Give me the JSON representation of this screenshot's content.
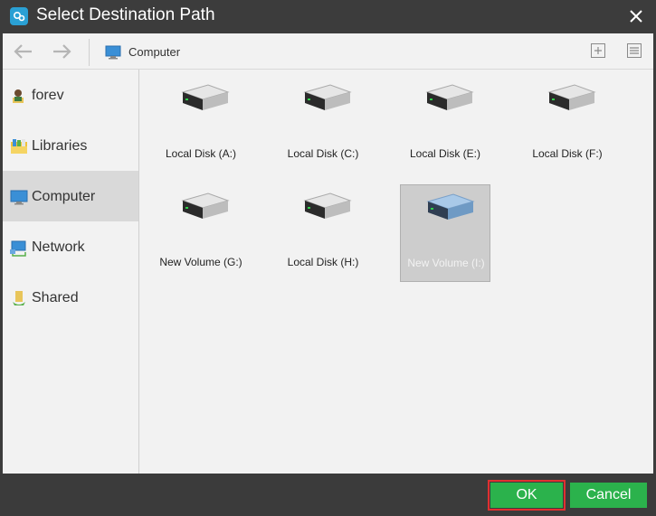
{
  "window": {
    "title": "Select Destination Path"
  },
  "toolbar": {
    "location": "Computer"
  },
  "sidebar": {
    "items": [
      {
        "label": "forev",
        "icon": "user-folder-icon"
      },
      {
        "label": "Libraries",
        "icon": "libraries-icon"
      },
      {
        "label": "Computer",
        "icon": "computer-icon",
        "selected": true
      },
      {
        "label": "Network",
        "icon": "network-icon"
      },
      {
        "label": "Shared",
        "icon": "shared-icon"
      }
    ]
  },
  "drives": [
    {
      "label": "Local Disk (A:)"
    },
    {
      "label": "Local Disk (C:)"
    },
    {
      "label": "Local Disk (E:)"
    },
    {
      "label": "Local Disk (F:)"
    },
    {
      "label": "New Volume (G:)"
    },
    {
      "label": "Local Disk (H:)"
    },
    {
      "label": "New Volume (I:)",
      "selected": true
    }
  ],
  "footer": {
    "ok_label": "OK",
    "cancel_label": "Cancel"
  },
  "colors": {
    "accent_green": "#2bb24c",
    "titlebar": "#3c3c3c",
    "panel": "#f2f2f2",
    "selected_drive": "#8bb3d9"
  }
}
